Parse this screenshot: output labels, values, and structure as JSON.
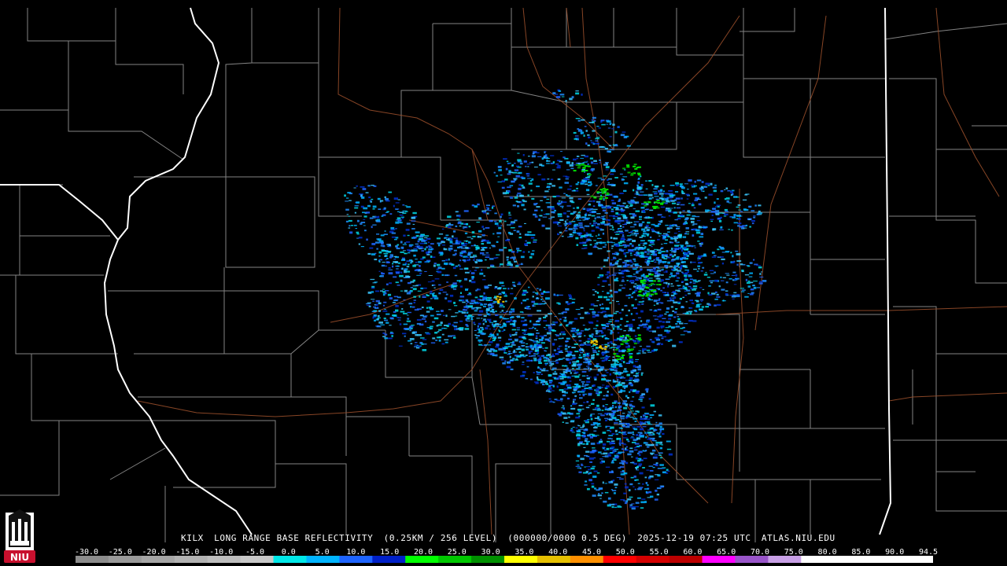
{
  "caption": {
    "station": "KILX",
    "product": "LONG RANGE BASE REFLECTIVITY",
    "resolution": "(0.25KM / 256 LEVEL)",
    "code": "(000000/0000 0.5 DEG)",
    "timestamp": "2025-12-19 07:25 UTC",
    "site": "ATLAS.NIU.EDU"
  },
  "colorbar": {
    "labels": [
      "-30.0",
      "-25.0",
      "-20.0",
      "-15.0",
      "-10.0",
      "-5.0",
      "0.0",
      "5.0",
      "10.0",
      "15.0",
      "20.0",
      "25.0",
      "30.0",
      "35.0",
      "40.0",
      "45.0",
      "50.0",
      "55.0",
      "60.0",
      "65.0",
      "70.0",
      "75.0",
      "80.0",
      "85.0",
      "90.0",
      "94.5"
    ],
    "colors": [
      "#8c8c8c",
      "#9a9a9a",
      "#a6a6a6",
      "#b2b2b2",
      "#bdbdbd",
      "#c8c8c8",
      "#00e8e8",
      "#00b4ff",
      "#1e64ff",
      "#0020c8",
      "#00ff00",
      "#00c800",
      "#009000",
      "#ffff00",
      "#e6c000",
      "#ff9000",
      "#ff0000",
      "#d40000",
      "#bc0000",
      "#ff00ff",
      "#9955c9",
      "#c8a0e6",
      "#ffffff",
      "#ffffff",
      "#ffffff",
      "#ffffff"
    ]
  },
  "logo": {
    "text": "NIU"
  },
  "colors": {
    "background": "#000000",
    "county": "#b4b4b4",
    "state": "#ffffff",
    "road": "#a0522d"
  }
}
